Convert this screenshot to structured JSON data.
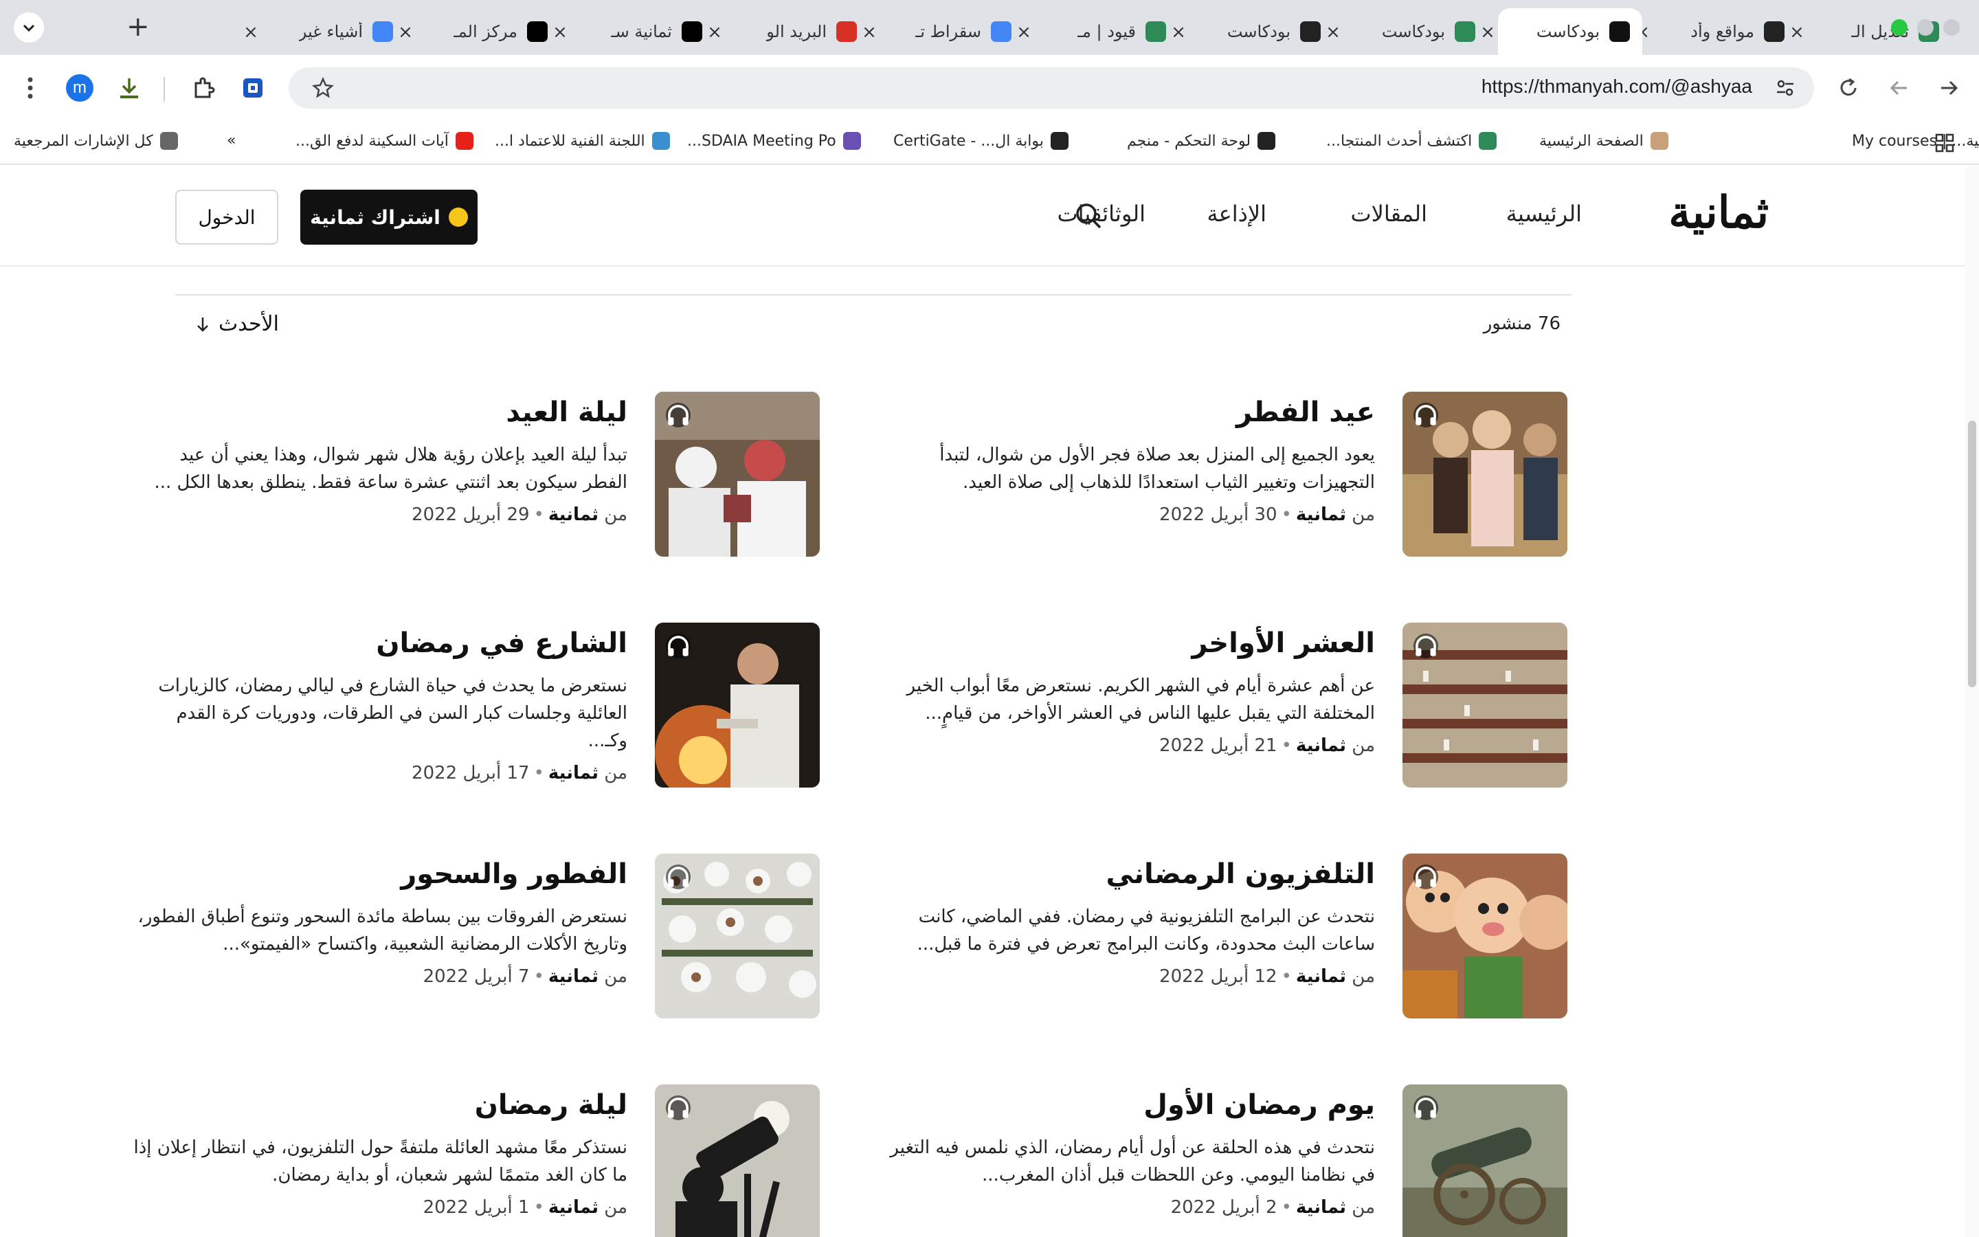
{
  "browser": {
    "tabs": [
      {
        "title": "تعديل الـ",
        "favicon": "green-star",
        "color": "#2e8b57",
        "active": false
      },
      {
        "title": "مواقع وأد",
        "favicon": "openai",
        "color": "#222222",
        "active": false
      },
      {
        "title": "بودكاست",
        "favicon": "thmanyah",
        "color": "#111111",
        "active": true
      },
      {
        "title": "بودكاست",
        "favicon": "green-star",
        "color": "#2e8b57",
        "active": false
      },
      {
        "title": "بودكاست",
        "favicon": "openai",
        "color": "#222222",
        "active": false
      },
      {
        "title": "قيود | مـ",
        "favicon": "green-star",
        "color": "#2e8b57",
        "active": false
      },
      {
        "title": "سقراط تـ",
        "favicon": "google",
        "color": "#4285f4",
        "active": false
      },
      {
        "title": "البريد الو",
        "favicon": "gmail",
        "color": "#d93025",
        "active": false
      },
      {
        "title": "ثمانية سـ",
        "favicon": "x",
        "color": "#000000",
        "active": false
      },
      {
        "title": "مركز المـ",
        "favicon": "x",
        "color": "#000000",
        "active": false
      },
      {
        "title": "أشياء غير",
        "favicon": "google",
        "color": "#4285f4",
        "active": false
      }
    ],
    "url": "https://thmanyah.com/@ashyaa",
    "profile_initial": "m",
    "bookmarks": [
      {
        "label": "الكلية... | My courses",
        "icon": "openai"
      },
      {
        "label": "الصفحة الرئيسية",
        "icon": "profile"
      },
      {
        "label": "اكتشف أحدث المنتجا...",
        "icon": "green-star"
      },
      {
        "label": "لوحة التحكم - منجم",
        "icon": "globe"
      },
      {
        "label": "بوابة ال... - CertiGate",
        "icon": "globe"
      },
      {
        "label": "SDAIA Meeting Po...",
        "icon": "sdaia"
      },
      {
        "label": "اللجنة الفنية للاعتماد ا...",
        "icon": "ncaaa"
      },
      {
        "label": "آيات السكينة لدفع الق...",
        "icon": "youtube"
      },
      {
        "label": "»",
        "icon": ""
      },
      {
        "label": "كل الإشارات المرجعية",
        "icon": "folder"
      }
    ]
  },
  "site": {
    "logo": "ثمانية",
    "nav": [
      "الرئيسية",
      "المقالات",
      "الإذاعة",
      "الوثائقيات"
    ],
    "subscribe_label": "اشتراك ثمانية",
    "login_label": "الدخول"
  },
  "listing": {
    "post_count": "76 منشور",
    "sort_label": "الأحدث",
    "from_label": "من",
    "posts": [
      {
        "title": "عيد الفطر",
        "desc": "يعود الجميع إلى المنزل بعد صلاة فجر الأول من شوال، لتبدأ التجهيزات وتغيير الثياب استعدادًا للذهاب إلى صلاة العيد.",
        "author": "ثمانية",
        "date": "30 أبريل 2022",
        "thumb": "children"
      },
      {
        "title": "ليلة العيد",
        "desc": "تبدأ ليلة العيد بإعلان رؤية هلال شهر شوال، وهذا يعني أن عيد الفطر سيكون بعد اثنتي عشرة ساعة فقط. ينطلق بعدها الكل ...",
        "author": "ثمانية",
        "date": "29 أبريل 2022",
        "thumb": "crowd"
      },
      {
        "title": "العشر الأواخر",
        "desc": "عن أهم عشرة أيام في الشهر الكريم. نستعرض معًا أبواب الخير المختلفة التي يقبل عليها الناس في العشر الأواخر، من قيامٍ...",
        "author": "ثمانية",
        "date": "21 أبريل 2022",
        "thumb": "mosque"
      },
      {
        "title": "الشارع في رمضان",
        "desc": "نستعرض ما يحدث في حياة الشارع في ليالي رمضان، كالزيارات العائلية وجلسات كبار السن في الطرقات، ودوريات كرة القدم وكـ...",
        "author": "ثمانية",
        "date": "17 أبريل 2022",
        "thumb": "cooking"
      },
      {
        "title": "التلفزيون الرمضاني",
        "desc": "نتحدث عن البرامج التلفزيونية في رمضان. ففي الماضي، كانت ساعات البث محدودة، وكانت البرامج تعرض في فترة ما قبل...",
        "author": "ثمانية",
        "date": "12 أبريل 2022",
        "thumb": "puppets"
      },
      {
        "title": "الفطور والسحور",
        "desc": "نستعرض الفروقات بين بساطة مائدة السحور وتنوع أطباق الفطور، وتاريخ الأكلات الرمضانية الشعبية، واكتساح «الفيمتو»...",
        "author": "ثمانية",
        "date": "7 أبريل 2022",
        "thumb": "iftar"
      },
      {
        "title": "يوم رمضان الأول",
        "desc": "نتحدث في هذه الحلقة عن أول أيام رمضان، الذي نلمس فيه التغير في نظامنا اليومي. وعن اللحظات قبل أذان المغرب...",
        "author": "ثمانية",
        "date": "2 أبريل 2022",
        "thumb": "cannon"
      },
      {
        "title": "ليلة رمضان",
        "desc": "نستذكر معًا مشهد العائلة ملتفةً حول التلفزيون، في انتظار إعلان إذا ما كان الغد متممًا لشهر شعبان، أو بداية رمضان.",
        "author": "ثمانية",
        "date": "1 أبريل 2022",
        "thumb": "telescope"
      }
    ]
  }
}
